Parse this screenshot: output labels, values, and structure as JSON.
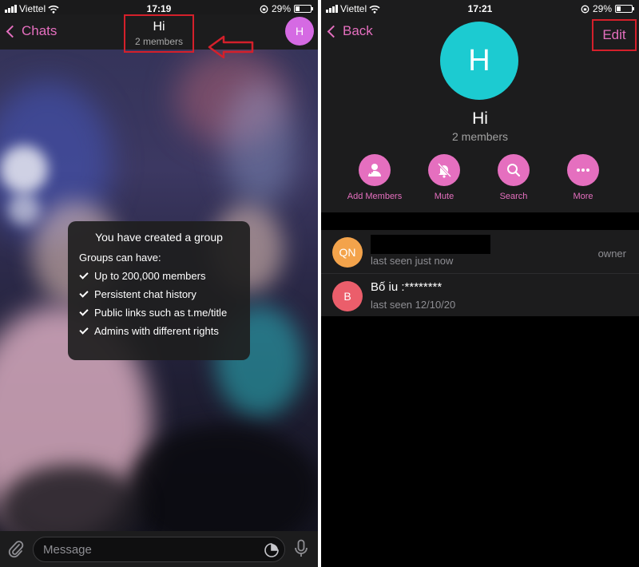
{
  "left_screen": {
    "status": {
      "carrier": "Viettel",
      "time": "17:19",
      "battery": "29%",
      "battery_level": 0.29
    },
    "header": {
      "back_label": "Chats",
      "title": "Hi",
      "subtitle": "2 members",
      "avatar_letter": "H"
    },
    "info_card": {
      "heading": "You have created a group",
      "intro": "Groups can have:",
      "items": [
        "Up to 200,000 members",
        "Persistent chat history",
        "Public links such as t.me/title",
        "Admins with different rights"
      ]
    },
    "input": {
      "placeholder": "Message"
    }
  },
  "right_screen": {
    "status": {
      "carrier": "Viettel",
      "time": "17:21",
      "battery": "29%",
      "battery_level": 0.29
    },
    "header": {
      "back_label": "Back",
      "edit_label": "Edit"
    },
    "profile": {
      "avatar_letter": "H",
      "name": "Hi",
      "member_count": "2 members"
    },
    "actions": [
      {
        "label": "Add Members",
        "icon": "add-person-icon"
      },
      {
        "label": "Mute",
        "icon": "bell-off-icon"
      },
      {
        "label": "Search",
        "icon": "search-icon"
      },
      {
        "label": "More",
        "icon": "more-icon"
      }
    ],
    "members": [
      {
        "initials": "QN",
        "name": "",
        "status": "last seen just now",
        "role": "owner",
        "avatar_color": "#f3a34b"
      },
      {
        "initials": "B",
        "name": "Bố iu :********",
        "status": "last seen 12/10/20",
        "role": "",
        "avatar_color": "#eb5e6b"
      }
    ]
  },
  "colors": {
    "accent": "#e56fbf",
    "highlight_red": "#d4202b",
    "group_avatar": "#1ccbd1",
    "small_avatar": "#d56ae3"
  }
}
